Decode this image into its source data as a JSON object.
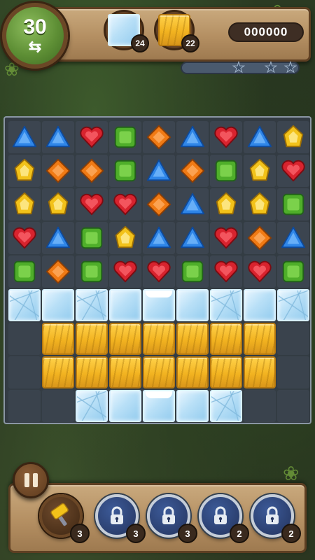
{
  "header": {
    "moves": "30",
    "moves_icon": "swap-arrows-icon",
    "goals": [
      {
        "type": "ice",
        "count": "24"
      },
      {
        "type": "wood",
        "count": "22"
      }
    ],
    "score": "000000",
    "star_progress": 0,
    "stars": [
      "star-icon",
      "star-icon",
      "star-icon"
    ]
  },
  "board": {
    "rows": [
      [
        "blue-triangle",
        "blue-triangle",
        "red-heart",
        "green-square",
        "orange-diamond",
        "blue-triangle",
        "red-heart",
        "blue-triangle",
        "yellow-drop"
      ],
      [
        "yellow-drop",
        "orange-diamond",
        "orange-diamond",
        "green-square",
        "blue-triangle",
        "orange-diamond",
        "green-square",
        "yellow-drop",
        "red-heart"
      ],
      [
        "yellow-drop",
        "yellow-drop",
        "red-heart",
        "red-heart",
        "orange-diamond",
        "blue-triangle",
        "yellow-drop",
        "yellow-drop",
        "green-square"
      ],
      [
        "red-heart",
        "blue-triangle",
        "green-square",
        "yellow-drop",
        "blue-triangle",
        "blue-triangle",
        "red-heart",
        "orange-diamond",
        "blue-triangle"
      ],
      [
        "green-square",
        "orange-diamond",
        "green-square",
        "red-heart",
        "red-heart",
        "green-square",
        "red-heart",
        "red-heart",
        "green-square"
      ],
      [
        "ice-cracked",
        "ice",
        "ice-cracked",
        "ice",
        "ice-snow",
        "ice",
        "ice-cracked",
        "ice",
        "ice-cracked"
      ],
      [
        "empty",
        "wood",
        "wood",
        "wood",
        "wood",
        "wood",
        "wood",
        "wood",
        "empty"
      ],
      [
        "empty",
        "wood",
        "wood",
        "wood",
        "wood",
        "wood",
        "wood",
        "wood",
        "empty"
      ],
      [
        "empty",
        "empty",
        "ice-cracked",
        "ice",
        "ice-snow",
        "ice",
        "ice-cracked",
        "empty",
        "empty"
      ]
    ]
  },
  "colors": {
    "blue": "#2f86e8",
    "red": "#d8232e",
    "green": "#4fae2a",
    "orange": "#f07a14",
    "yellow": "#f2c21a"
  },
  "boosters": [
    {
      "name": "hammer",
      "icon": "hammer-icon",
      "count": "3",
      "locked": false
    },
    {
      "name": "booster-2",
      "icon": "lock-icon",
      "count": "3",
      "locked": true
    },
    {
      "name": "booster-3",
      "icon": "lock-icon",
      "count": "3",
      "locked": true
    },
    {
      "name": "booster-4",
      "icon": "lock-icon",
      "count": "2",
      "locked": true
    },
    {
      "name": "booster-5",
      "icon": "lock-icon",
      "count": "2",
      "locked": true
    }
  ],
  "controls": {
    "pause_icon": "pause-icon"
  }
}
